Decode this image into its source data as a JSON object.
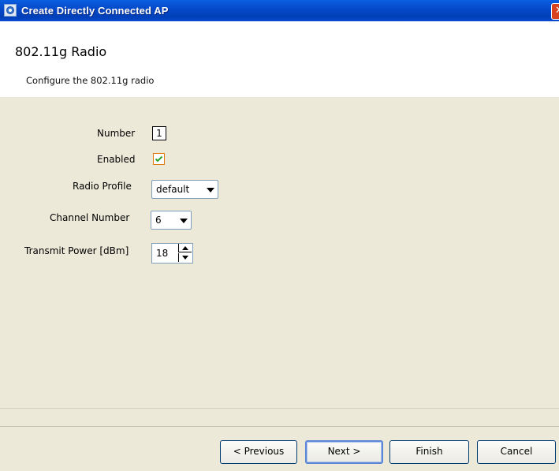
{
  "window": {
    "title": "Create Directly Connected AP",
    "close_symbol": "✕",
    "app_icon": "app-icon"
  },
  "header": {
    "title": "802.11g Radio",
    "subtitle": "Configure the 802.11g radio"
  },
  "form": {
    "number": {
      "label": "Number",
      "value": "1"
    },
    "enabled": {
      "label": "Enabled",
      "checked": true
    },
    "radio_profile": {
      "label": "Radio Profile",
      "value": "default"
    },
    "channel_number": {
      "label": "Channel Number",
      "value": "6"
    },
    "transmit_power": {
      "label": "Transmit Power [dBm]",
      "value": "18"
    }
  },
  "footer": {
    "previous_label": "< Previous",
    "next_label": "Next >",
    "finish_label": "Finish",
    "cancel_label": "Cancel"
  },
  "colors": {
    "titlebar": "#0548c8",
    "panel": "#ece9d8",
    "checkbox_border": "#e07c12",
    "checkmark": "#2aa52a"
  }
}
